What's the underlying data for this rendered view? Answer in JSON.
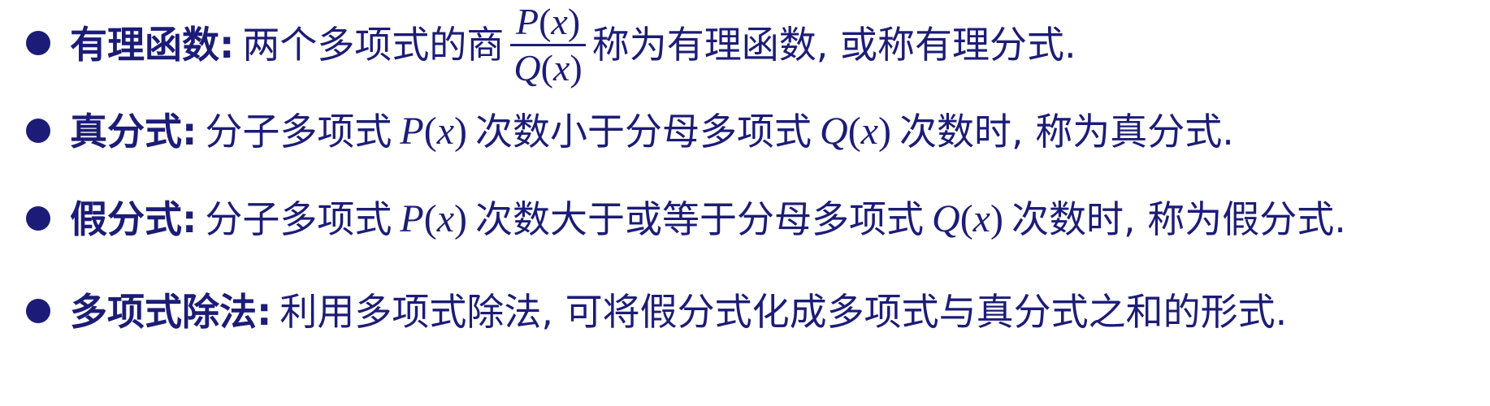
{
  "items": [
    {
      "term": "有理函数:",
      "text1": "两个多项式的商",
      "fraction": {
        "numerator": "P",
        "denominator": "Q",
        "variable": "x"
      },
      "text2": "称为有理函数, 或称有理分式."
    },
    {
      "term": "真分式:",
      "text1": "分子多项式",
      "math1": "P",
      "text2": "次数小于分母多项式",
      "math2": "Q",
      "variable": "x",
      "text3": "次数时, 称为真分式."
    },
    {
      "term": "假分式:",
      "text1": "分子多项式",
      "math1": "P",
      "text2": "次数大于或等于分母多项式",
      "math2": "Q",
      "variable": "x",
      "text3": "次数时, 称为假分式."
    },
    {
      "term": "多项式除法:",
      "text1": "利用多项式除法, 可将假分式化成多项式与真分式之和的形式."
    }
  ]
}
